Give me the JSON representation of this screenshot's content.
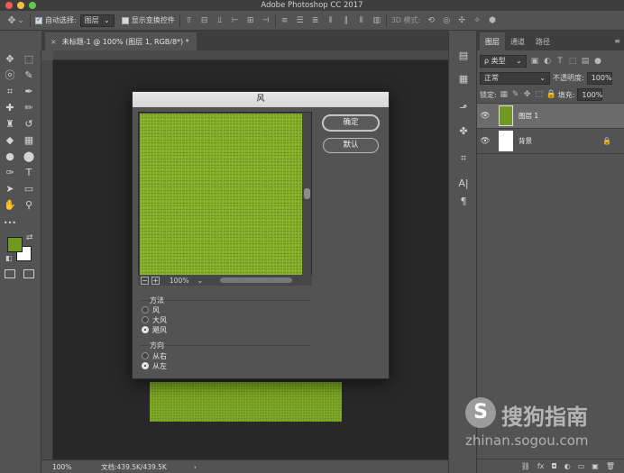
{
  "app": {
    "title": "Adobe Photoshop CC 2017",
    "traffic_colors": [
      "#ee5b53",
      "#f7bd40",
      "#5fc84b"
    ]
  },
  "options_bar": {
    "auto_select_label": "自动选择:",
    "auto_select_checked": true,
    "auto_select_target": "图层",
    "show_transform_label": "显示变换控件",
    "show_transform_checked": false,
    "mode_3d_label": "3D 模式:"
  },
  "document": {
    "tab_title": "未标题-1 @ 100% (图层 1, RGB/8*) *",
    "close_icon": "×",
    "status_zoom": "100%",
    "status_doc": "文档:439.5K/439.5K",
    "status_arrow": "›",
    "grass_color": "#7aa322"
  },
  "colors": {
    "foreground": "#6f9a1f",
    "background": "#ffffff",
    "accent_grass": "#84ae2a"
  },
  "tools": [
    {
      "name": "move-tool-icon",
      "glyph": "✥"
    },
    {
      "name": "marquee-tool-icon",
      "glyph": "⬚"
    },
    {
      "name": "lasso-tool-icon",
      "glyph": "ⓞ"
    },
    {
      "name": "quick-select-tool-icon",
      "glyph": "✎"
    },
    {
      "name": "crop-tool-icon",
      "glyph": "⌗"
    },
    {
      "name": "eyedropper-tool-icon",
      "glyph": "✒"
    },
    {
      "name": "healing-tool-icon",
      "glyph": "✚"
    },
    {
      "name": "brush-tool-icon",
      "glyph": "✏"
    },
    {
      "name": "stamp-tool-icon",
      "glyph": "♜"
    },
    {
      "name": "history-brush-tool-icon",
      "glyph": "↺"
    },
    {
      "name": "eraser-tool-icon",
      "glyph": "◆"
    },
    {
      "name": "gradient-tool-icon",
      "glyph": "▦"
    },
    {
      "name": "blur-tool-icon",
      "glyph": "●"
    },
    {
      "name": "dodge-tool-icon",
      "glyph": "⬤"
    },
    {
      "name": "pen-tool-icon",
      "glyph": "✑"
    },
    {
      "name": "type-tool-icon",
      "glyph": "T"
    },
    {
      "name": "path-select-tool-icon",
      "glyph": "➤"
    },
    {
      "name": "shape-tool-icon",
      "glyph": "▭"
    },
    {
      "name": "hand-tool-icon",
      "glyph": "✋"
    },
    {
      "name": "zoom-tool-icon",
      "glyph": "⚲"
    },
    {
      "name": "more-tools-icon",
      "glyph": "•••"
    }
  ],
  "layers_panel": {
    "tabs": [
      "图层",
      "通道",
      "路径"
    ],
    "active_tab": 0,
    "filter_label": "ρ 类型",
    "blend_mode": "正常",
    "opacity_label": "不透明度:",
    "opacity_value": "100%",
    "lock_label": "锁定:",
    "fill_label": "填充:",
    "fill_value": "100%",
    "layers": [
      {
        "name": "图层 1",
        "selected": true,
        "thumb": "#6f9a1f"
      },
      {
        "name": "背景",
        "selected": false,
        "thumb": "#ffffff",
        "locked": true
      }
    ],
    "footer_icons": [
      "⛓",
      "fx",
      "◘",
      "◐",
      "▭",
      "▣",
      "🗑"
    ]
  },
  "dialog": {
    "title": "风",
    "ok_label": "确定",
    "default_label": "默认",
    "zoom_value": "100%",
    "zoom_minus": "−",
    "zoom_plus": "+",
    "method_label": "方法",
    "methods": [
      {
        "label": "风",
        "selected": false
      },
      {
        "label": "大风",
        "selected": false
      },
      {
        "label": "飓风",
        "selected": true
      }
    ],
    "direction_label": "方向",
    "directions": [
      {
        "label": "从右",
        "selected": false
      },
      {
        "label": "从左",
        "selected": true
      }
    ]
  },
  "watermark": {
    "logo_char": "S",
    "brand": "搜狗指南",
    "url": "zhinan.sogou.com"
  }
}
